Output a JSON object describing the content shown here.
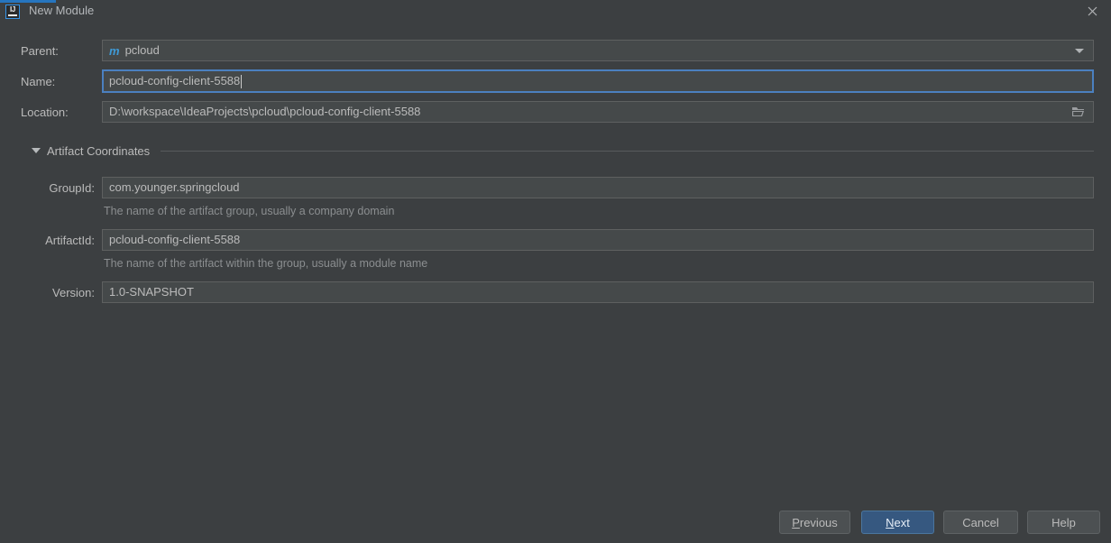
{
  "window": {
    "title": "New Module",
    "app_icon_text": "IJ",
    "close_icon": "close-icon",
    "accent_color": "#2675bf",
    "background_color": "#3c3f41"
  },
  "form": {
    "parent": {
      "label": "Parent:",
      "module_icon": "m",
      "value": "pcloud",
      "dropdown_icon": "chevron-down-icon"
    },
    "name": {
      "label": "Name:",
      "value": "pcloud-config-client-5588",
      "focused": "true"
    },
    "location": {
      "label": "Location:",
      "value": "D:\\workspace\\IdeaProjects\\pcloud\\pcloud-config-client-5588",
      "browse_icon": "folder-icon"
    }
  },
  "artifact_coordinates": {
    "section_title": "Artifact Coordinates",
    "expanded": "true",
    "group_id": {
      "label": "GroupId:",
      "value": "com.younger.springcloud",
      "hint": "The name of the artifact group, usually a company domain"
    },
    "artifact_id": {
      "label": "ArtifactId:",
      "value": "pcloud-config-client-5588",
      "hint": "The name of the artifact within the group, usually a module name"
    },
    "version": {
      "label": "Version:",
      "value": "1.0-SNAPSHOT"
    }
  },
  "buttons": {
    "previous": "Previous",
    "previous_mnemonic": "P",
    "next": "Next",
    "next_mnemonic": "N",
    "cancel": "Cancel",
    "help": "Help",
    "default_button_color": "#365880"
  }
}
